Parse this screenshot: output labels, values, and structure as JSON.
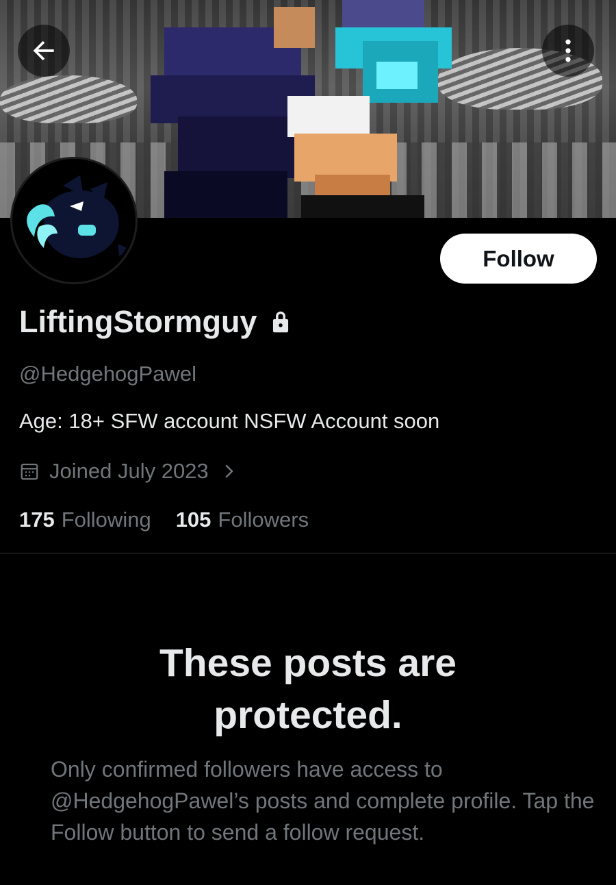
{
  "header": {
    "back_icon": "arrow-left-icon",
    "more_icon": "more-vertical-icon"
  },
  "profile": {
    "display_name": "LiftingStormguy",
    "lock_icon": "lock-icon",
    "handle": "@HedgehogPawel",
    "bio": "Age: 18+ SFW account NSFW Account soon",
    "joined_icon": "calendar-icon",
    "joined": "Joined July 2023",
    "joined_chevron_icon": "chevron-right-icon",
    "following_count": "175",
    "following_label": "Following",
    "followers_count": "105",
    "followers_label": "Followers"
  },
  "actions": {
    "follow_label": "Follow"
  },
  "protected": {
    "title": "These posts are protected.",
    "body": "Only confirmed followers have access to @HedgehogPawel’s posts and complete profile. Tap the Follow button to send a follow request."
  },
  "colors": {
    "background": "#000000",
    "text_primary": "#e7e9ea",
    "text_secondary": "#71767b",
    "follow_button": "#ffffff",
    "avatar_accent": "#5ce1e6"
  }
}
